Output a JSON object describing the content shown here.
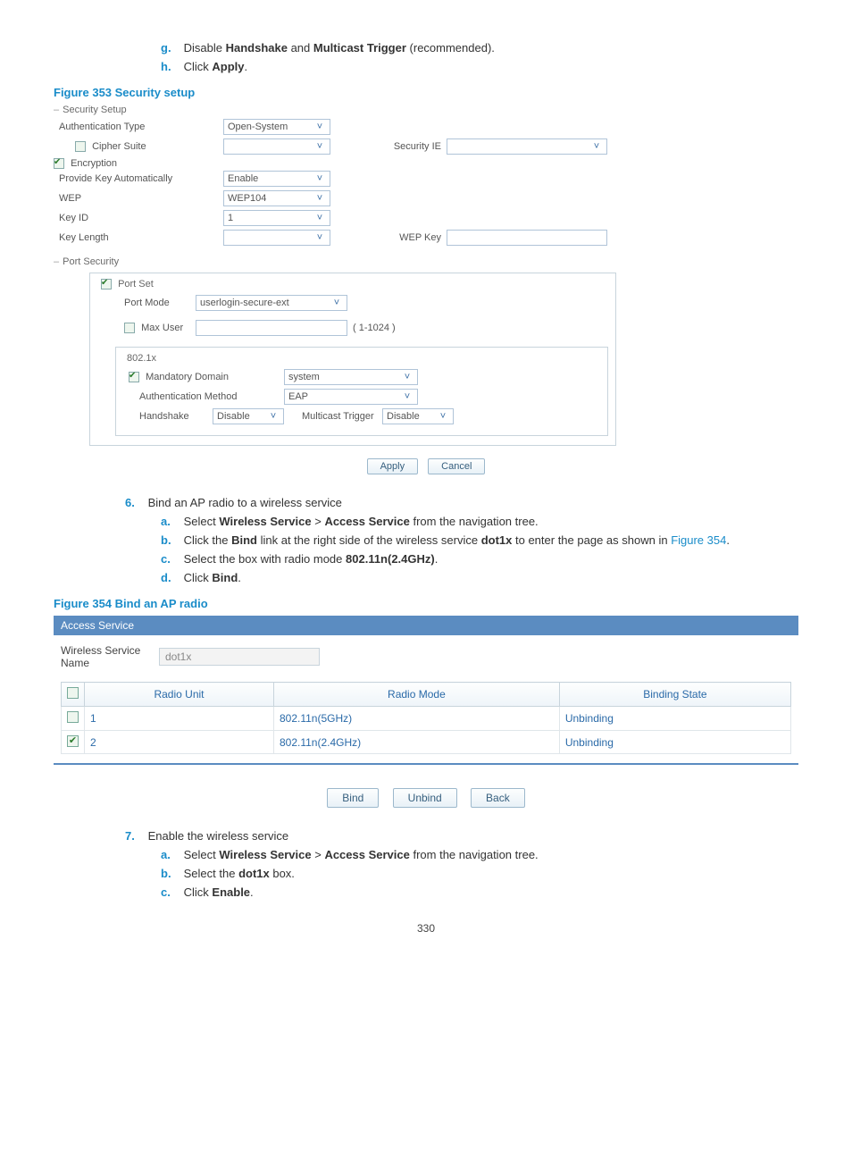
{
  "intro_steps": {
    "g": {
      "pre": "Disable ",
      "b1": "Handshake",
      "mid": " and ",
      "b2": "Multicast Trigger",
      "post": " (recommended)."
    },
    "h": {
      "pre": "Click ",
      "b1": "Apply",
      "post": "."
    }
  },
  "fig353": {
    "caption": "Figure 353 Security setup",
    "security_header": "Security Setup",
    "auth_type_lbl": "Authentication Type",
    "auth_type_val": "Open-System",
    "cipher_lbl": "Cipher Suite",
    "security_ie_lbl": "Security IE",
    "enc_header": "Encryption",
    "pka_lbl": "Provide Key Automatically",
    "pka_val": "Enable",
    "wep_lbl": "WEP",
    "wep_val": "WEP104",
    "keyid_lbl": "Key ID",
    "keyid_val": "1",
    "keylen_lbl": "Key Length",
    "wepkey_lbl": "WEP Key",
    "portsec_header": "Port Security",
    "portset_header": "Port Set",
    "portmode_lbl": "Port Mode",
    "portmode_val": "userlogin-secure-ext",
    "maxuser_lbl": "Max User",
    "maxuser_hint": "( 1-1024 )",
    "dot1x_header": "802.1x",
    "manddom_lbl": "Mandatory Domain",
    "manddom_val": "system",
    "authmeth_lbl": "Authentication Method",
    "authmeth_val": "EAP",
    "handshake_lbl": "Handshake",
    "handshake_val": "Disable",
    "multi_lbl": "Multicast Trigger",
    "multi_val": "Disable",
    "apply_btn": "Apply",
    "cancel_btn": "Cancel"
  },
  "step6": {
    "num": "6.",
    "title": "Bind an AP radio to a wireless service",
    "a": {
      "pre": "Select ",
      "b1": "Wireless Service",
      "sep": " > ",
      "b2": "Access Service",
      "post": " from the navigation tree."
    },
    "b": {
      "pre": "Click the ",
      "b1": "Bind",
      "mid": " link at the right side of the wireless service ",
      "b2": "dot1x",
      "post": " to enter the page as shown in ",
      "link": "Figure 354",
      "post2": "."
    },
    "c": {
      "pre": "Select the box with radio mode ",
      "b1": "802.11n(2.4GHz)",
      "post": "."
    },
    "d": {
      "pre": "Click ",
      "b1": "Bind",
      "post": "."
    }
  },
  "fig354": {
    "caption": "Figure 354 Bind an AP radio",
    "panel_title": "Access Service",
    "svc_lbl1": "Wireless Service",
    "svc_lbl2": "Name",
    "svc_val": "dot1x",
    "col_unit": "Radio Unit",
    "col_mode": "Radio Mode",
    "col_state": "Binding State",
    "rows": [
      {
        "checked": false,
        "unit": "1",
        "mode": "802.11n(5GHz)",
        "state": "Unbinding"
      },
      {
        "checked": true,
        "unit": "2",
        "mode": "802.11n(2.4GHz)",
        "state": "Unbinding"
      }
    ],
    "bind_btn": "Bind",
    "unbind_btn": "Unbind",
    "back_btn": "Back"
  },
  "step7": {
    "num": "7.",
    "title": "Enable the wireless service",
    "a": {
      "pre": "Select ",
      "b1": "Wireless Service",
      "sep": " > ",
      "b2": "Access Service",
      "post": " from the navigation tree."
    },
    "b": {
      "pre": "Select the ",
      "b1": "dot1x",
      "post": " box."
    },
    "c": {
      "pre": "Click ",
      "b1": "Enable",
      "post": "."
    }
  },
  "page_number": "330"
}
